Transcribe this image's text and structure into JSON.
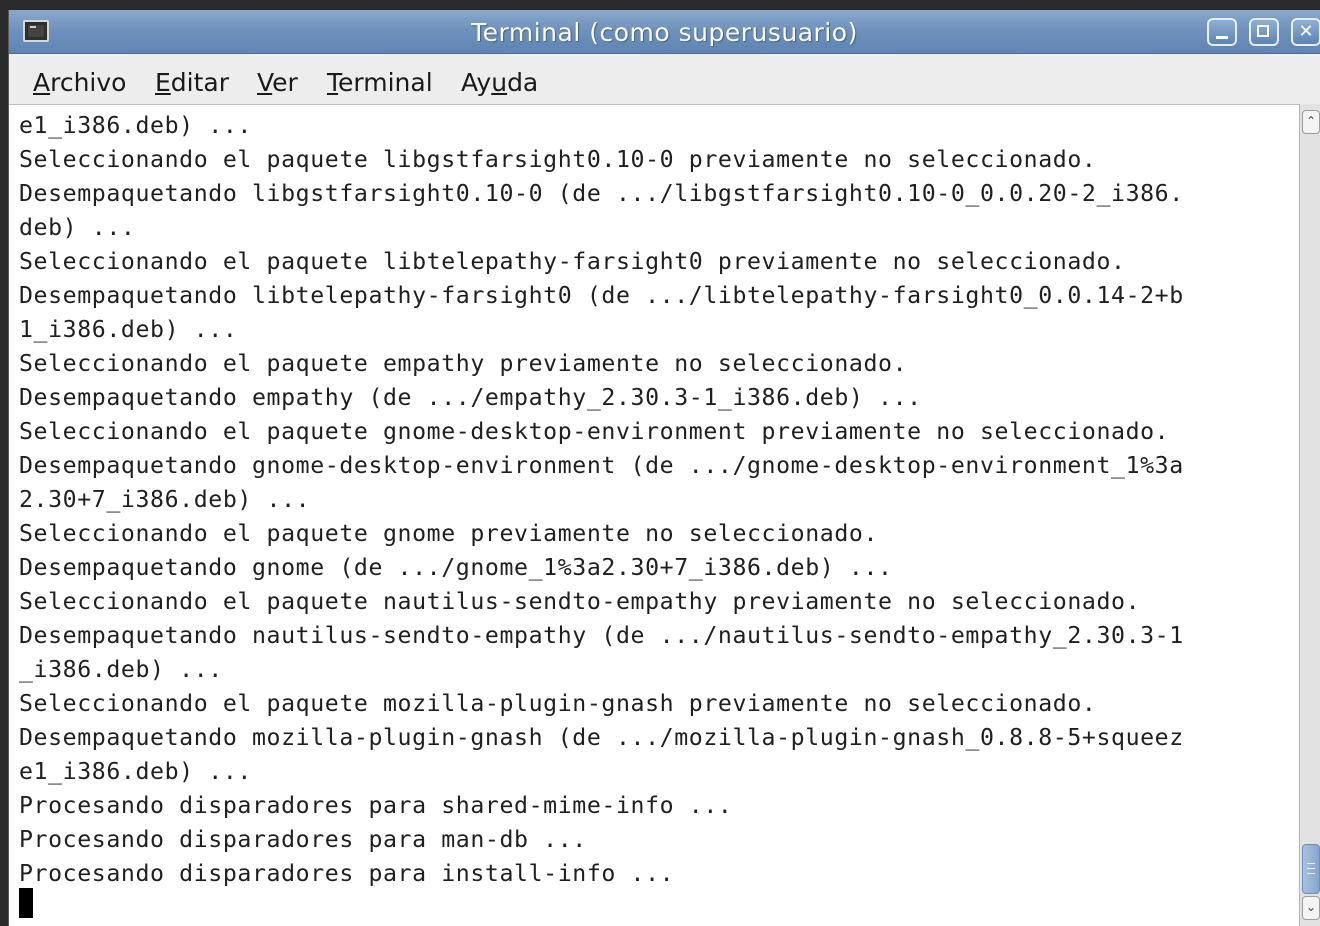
{
  "window": {
    "title": "Terminal (como superusuario)",
    "icon": "terminal-icon",
    "controls": {
      "minimize": "minimize-icon",
      "maximize": "maximize-icon",
      "close": "close-icon"
    },
    "close_glyph": "✕"
  },
  "menubar": {
    "items": [
      {
        "label_mnemonic": "A",
        "label_rest": "rchivo"
      },
      {
        "label_mnemonic": "E",
        "label_rest": "ditar"
      },
      {
        "label_mnemonic": "V",
        "label_rest": "er"
      },
      {
        "label_mnemonic": "T",
        "label_rest": "erminal"
      },
      {
        "label_prefix": "Ay",
        "label_mnemonic": "u",
        "label_rest": "da"
      }
    ]
  },
  "terminal": {
    "lines": [
      "e1_i386.deb) ...",
      "Seleccionando el paquete libgstfarsight0.10-0 previamente no seleccionado.",
      "Desempaquetando libgstfarsight0.10-0 (de .../libgstfarsight0.10-0_0.0.20-2_i386.",
      "deb) ...",
      "Seleccionando el paquete libtelepathy-farsight0 previamente no seleccionado.",
      "Desempaquetando libtelepathy-farsight0 (de .../libtelepathy-farsight0_0.0.14-2+b",
      "1_i386.deb) ...",
      "Seleccionando el paquete empathy previamente no seleccionado.",
      "Desempaquetando empathy (de .../empathy_2.30.3-1_i386.deb) ...",
      "Seleccionando el paquete gnome-desktop-environment previamente no seleccionado.",
      "Desempaquetando gnome-desktop-environment (de .../gnome-desktop-environment_1%3a",
      "2.30+7_i386.deb) ...",
      "Seleccionando el paquete gnome previamente no seleccionado.",
      "Desempaquetando gnome (de .../gnome_1%3a2.30+7_i386.deb) ...",
      "Seleccionando el paquete nautilus-sendto-empathy previamente no seleccionado.",
      "Desempaquetando nautilus-sendto-empathy (de .../nautilus-sendto-empathy_2.30.3-1",
      "_i386.deb) ...",
      "Seleccionando el paquete mozilla-plugin-gnash previamente no seleccionado.",
      "Desempaquetando mozilla-plugin-gnash (de .../mozilla-plugin-gnash_0.8.8-5+squeez",
      "e1_i386.deb) ...",
      "Procesando disparadores para shared-mime-info ...",
      "Procesando disparadores para man-db ...",
      "Procesando disparadores para install-info ..."
    ]
  },
  "scrollbar": {
    "up_glyph": "⌃",
    "down_glyph": "⌄",
    "position": 1.0
  }
}
